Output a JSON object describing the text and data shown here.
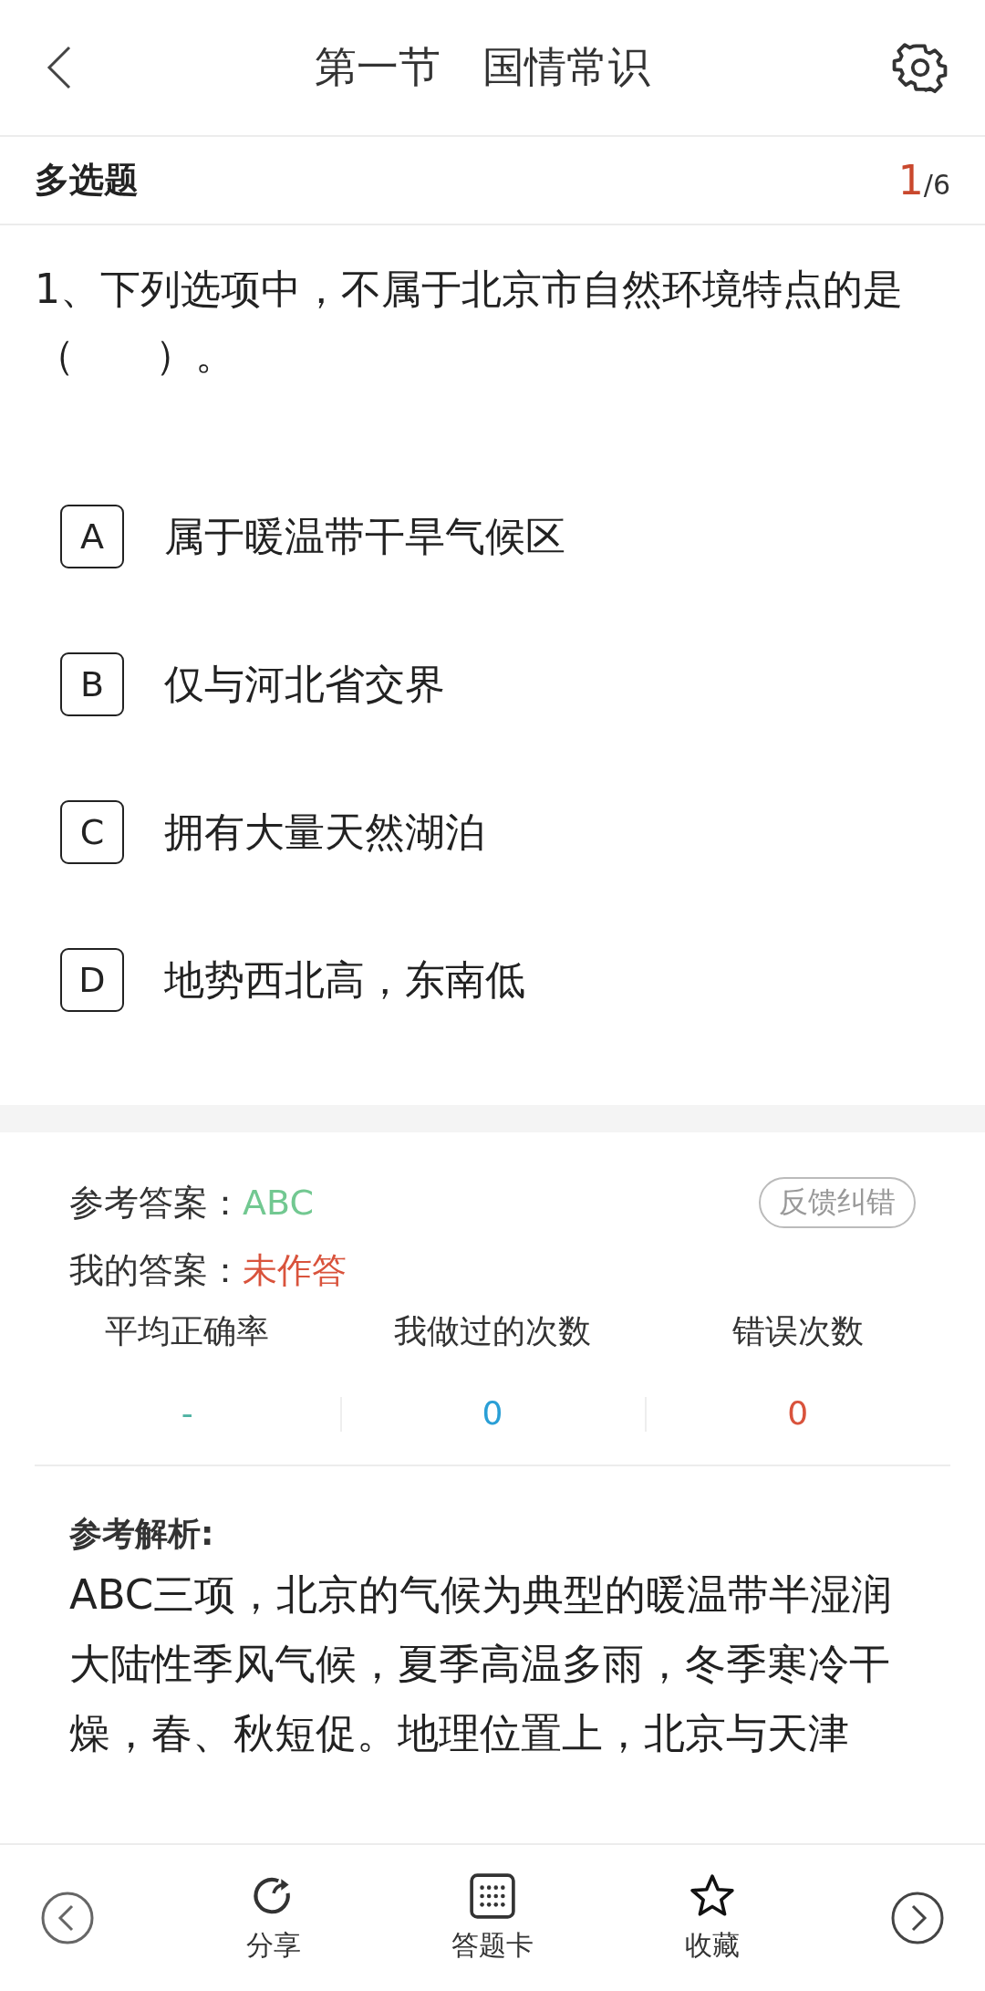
{
  "header": {
    "title": "第一节　国情常识"
  },
  "question_type": "多选题",
  "counter": {
    "current": "1",
    "total": "/6"
  },
  "question": {
    "text": "1、下列选项中，不属于北京市自然环境特点的是（　　）。"
  },
  "options": [
    {
      "letter": "A",
      "text": "属于暖温带干旱气候区"
    },
    {
      "letter": "B",
      "text": "仅与河北省交界"
    },
    {
      "letter": "C",
      "text": "拥有大量天然湖泊"
    },
    {
      "letter": "D",
      "text": "地势西北高，东南低"
    }
  ],
  "answers": {
    "reference_label": "参考答案：",
    "reference_value": "ABC",
    "mine_label": "我的答案：",
    "mine_value": "未作答",
    "feedback_button": "反馈纠错"
  },
  "stats": [
    {
      "label": "平均正确率",
      "value": "-",
      "color": "#4fb3a3"
    },
    {
      "label": "我做过的次数",
      "value": "0",
      "color": "#2a9fd6"
    },
    {
      "label": "错误次数",
      "value": "0",
      "color": "#d9533c"
    }
  ],
  "explanation": {
    "title": "参考解析:",
    "text": "ABC三项，北京的气候为典型的暖温带半湿润大陆性季风气候，夏季高温多雨，冬季寒冷干燥，春、秋短促。地理位置上，北京与天津"
  },
  "toolbar": [
    {
      "kind": "prev"
    },
    {
      "kind": "share",
      "label": "分享"
    },
    {
      "kind": "card",
      "label": "答题卡"
    },
    {
      "kind": "favorite",
      "label": "收藏"
    },
    {
      "kind": "next"
    }
  ]
}
